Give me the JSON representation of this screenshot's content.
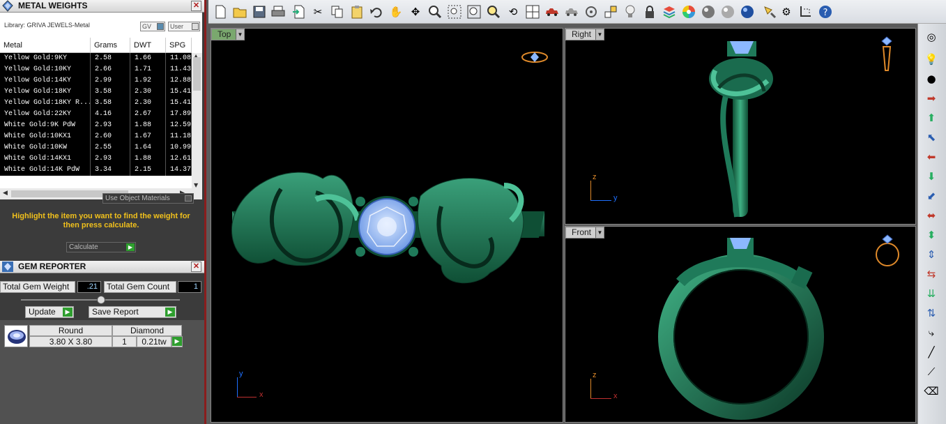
{
  "metal_weights": {
    "title": "METAL WEIGHTS",
    "library": "Library: GRIVA JEWELS-Metal",
    "toggle_gv": "GV",
    "toggle_user": "User",
    "columns": [
      "Metal",
      "Grams",
      "DWT",
      "SPG"
    ],
    "rows": [
      [
        "Yellow Gold:9KY",
        "2.58",
        "1.66",
        "11.08"
      ],
      [
        "Yellow Gold:10KY",
        "2.66",
        "1.71",
        "11.43"
      ],
      [
        "Yellow Gold:14KY",
        "2.99",
        "1.92",
        "12.88"
      ],
      [
        "Yellow Gold:18KY",
        "3.58",
        "2.30",
        "15.41"
      ],
      [
        "Yellow Gold:18KY R...",
        "3.58",
        "2.30",
        "15.41"
      ],
      [
        "Yellow Gold:22KY",
        "4.16",
        "2.67",
        "17.89"
      ],
      [
        "White Gold:9K PdW",
        "2.93",
        "1.88",
        "12.59"
      ],
      [
        "White Gold:10KX1",
        "2.60",
        "1.67",
        "11.18"
      ],
      [
        "White Gold:10KW",
        "2.55",
        "1.64",
        "10.99"
      ],
      [
        "White Gold:14KX1",
        "2.93",
        "1.88",
        "12.61"
      ],
      [
        "White Gold:14K PdW",
        "3.34",
        "2.15",
        "14.37"
      ]
    ],
    "use_object_materials": "Use Object Materials",
    "hint": "Highlight the item you want to find the weight for then press calculate.",
    "calculate": "Calculate"
  },
  "gem_reporter": {
    "title": "GEM REPORTER",
    "total_weight_label": "Total Gem Weight",
    "total_weight_value": ".21",
    "total_count_label": "Total Gem Count",
    "total_count_value": "1",
    "update": "Update",
    "save_report": "Save Report",
    "gem": {
      "shape": "Round",
      "material": "Diamond",
      "size": "3.80 X 3.80",
      "count": "1",
      "weight": "0.21tw"
    }
  },
  "viewports": {
    "top": {
      "label": "Top",
      "axis_v": "y",
      "axis_h": "x"
    },
    "right": {
      "label": "Right",
      "axis_v": "z",
      "axis_h": "y"
    },
    "front": {
      "label": "Front",
      "axis_v": "z",
      "axis_h": "x"
    }
  },
  "toolbar_icons": [
    "new-file",
    "open-folder",
    "save",
    "print",
    "import",
    "cut",
    "copy",
    "paste",
    "undo",
    "pan",
    "move",
    "zoom-in",
    "zoom-window",
    "zoom-extents",
    "zoom-selected",
    "rotate-view",
    "four-views",
    "render-car",
    "shaded-car",
    "orbit",
    "snap",
    "light",
    "lock",
    "layers",
    "color-wheel",
    "material-sphere",
    "gray-sphere",
    "blue-sphere",
    "flashlight",
    "settings-gear",
    "dimension",
    "help"
  ],
  "right_tools": [
    "camera-target",
    "light-bulb",
    "sphere",
    "arrow-right",
    "arrow-up",
    "arrow-up-left",
    "arrow-left",
    "arrow-down",
    "arrow-down-left",
    "arrows-horizontal",
    "arrows-vertical",
    "arrows-stack",
    "arrows-inward",
    "arrows-down-stack",
    "arrows-in",
    "curve-tool",
    "line-tool",
    "line-tool-2",
    "eraser"
  ],
  "colors": {
    "accent_red": "#8a1d1d",
    "gold_text": "#f0c01c",
    "ring_green": "#1f7a5a",
    "gem_blue": "#8cb8ff",
    "active_tab": "#7aa86e"
  }
}
